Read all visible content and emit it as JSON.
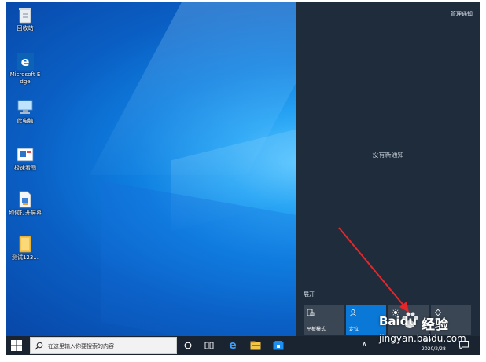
{
  "desktop": {
    "icons": [
      {
        "label": "回收站",
        "icon": "recycle-bin-icon"
      },
      {
        "label": "Microsoft Edge",
        "icon": "edge-icon"
      },
      {
        "label": "此电脑",
        "icon": "computer-icon"
      },
      {
        "label": "极速看图",
        "icon": "image-viewer-icon"
      },
      {
        "label": "如何打开屏幕",
        "icon": "document-icon"
      },
      {
        "label": "测试123...",
        "icon": "folder-icon"
      }
    ]
  },
  "action_center": {
    "manage_notifications": "管理通知",
    "empty_message": "没有新通知",
    "expand": "展开",
    "tiles": [
      {
        "label": "平板模式",
        "icon": "tablet-mode-icon",
        "active": false
      },
      {
        "label": "定位",
        "icon": "location-icon",
        "active": true
      },
      {
        "label": "",
        "icon": "brightness-icon",
        "active": false
      },
      {
        "label": "",
        "icon": "focus-assist-icon",
        "active": false
      }
    ]
  },
  "taskbar": {
    "search_placeholder": "在这里输入你要搜索的内容",
    "clock_time": "8:21",
    "clock_date": "2020/2/28"
  },
  "watermark": {
    "brand": "Baidu",
    "suffix": "经验",
    "url": "jingyan.baidu.com"
  },
  "colors": {
    "accent": "#0a78d7",
    "panel": "#1e2c3c",
    "taskbar": "#1a2431"
  }
}
